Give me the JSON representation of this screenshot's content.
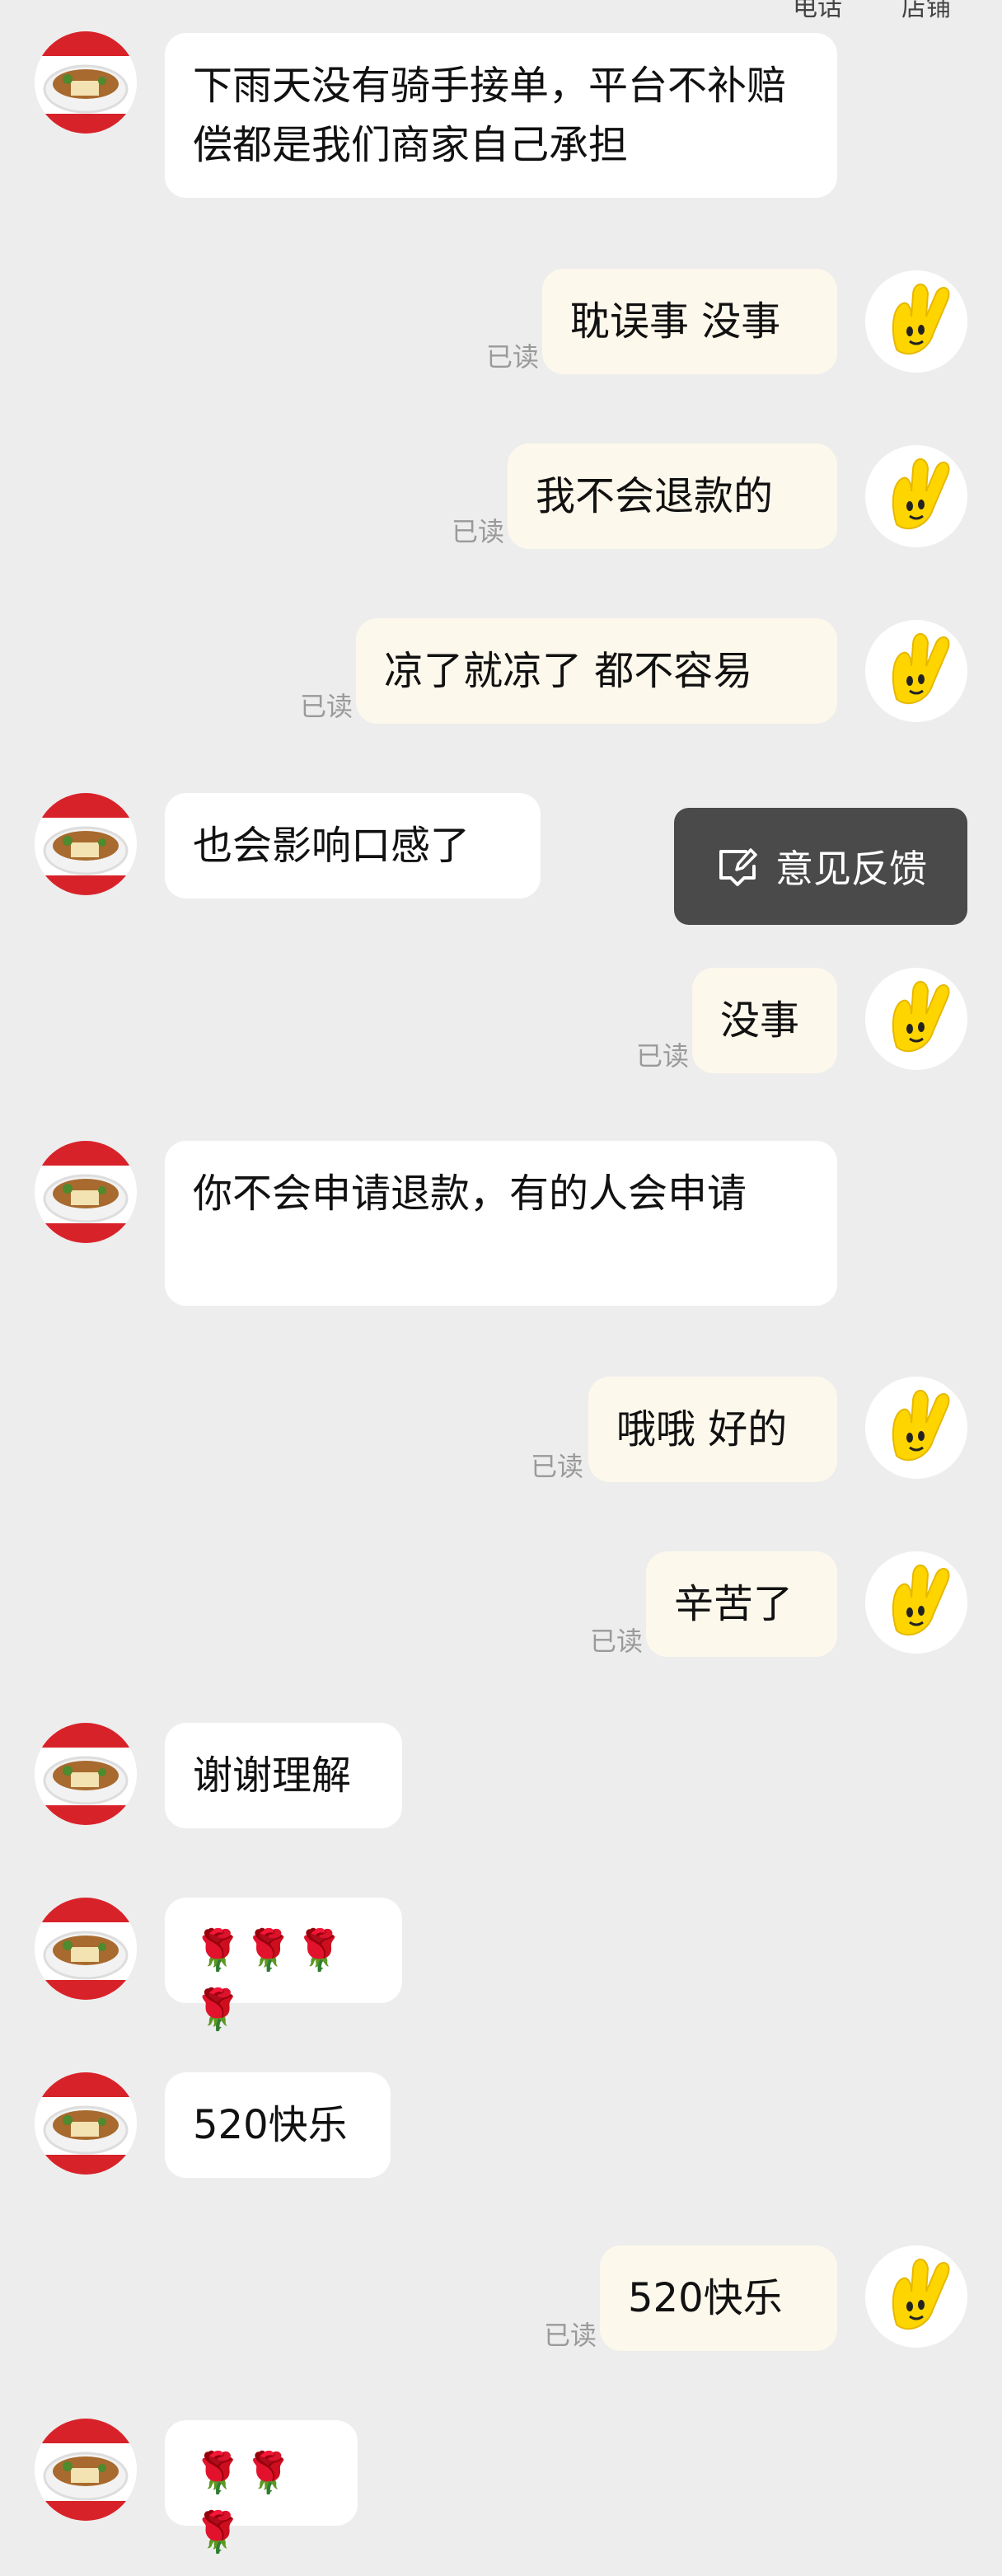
{
  "header": {
    "phone_label": "电话",
    "shop_label": "店铺"
  },
  "read_label": "已读",
  "feedback": {
    "label": "意见反馈",
    "icon": "feedback-icon"
  },
  "messages": [
    {
      "side": "in",
      "text": "下雨天没有骑手接单，平台不补赔偿都是我们商家自己承担"
    },
    {
      "side": "out",
      "text": "耽误事 没事"
    },
    {
      "side": "out",
      "text": "我不会退款的"
    },
    {
      "side": "out",
      "text": "凉了就凉了 都不容易"
    },
    {
      "side": "in",
      "text": "也会影响口感了"
    },
    {
      "side": "out",
      "text": "没事"
    },
    {
      "side": "in",
      "text": "你不会申请退款，有的人会申请"
    },
    {
      "side": "out",
      "text": "哦哦 好的"
    },
    {
      "side": "out",
      "text": "辛苦了"
    },
    {
      "side": "in",
      "text": "谢谢理解"
    },
    {
      "side": "in",
      "text": "🌹🌹🌹🌹"
    },
    {
      "side": "in",
      "text": "520快乐"
    },
    {
      "side": "out",
      "text": "520快乐"
    },
    {
      "side": "in",
      "text": "🌹🌹🌹"
    }
  ],
  "colors": {
    "background": "#ededed",
    "incoming_bubble": "#ffffff",
    "outgoing_bubble": "#fdf8ec",
    "feedback_bg": "#4a4a4a",
    "avatar_mascot": "#ffd500"
  }
}
